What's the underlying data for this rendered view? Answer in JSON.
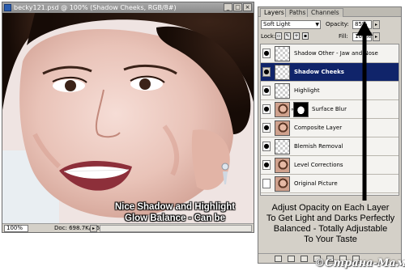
{
  "document": {
    "title": "becky121.psd @ 100% (Shadow Cheeks, RGB/8#)",
    "zoom": "100%",
    "doc_info": "Doc: 698.7K/6.54M",
    "overlay_text": "Nice Shadow and Highlight\nGlow Balance - Can be\nMore Dramatic if You Want"
  },
  "window_buttons": {
    "minimize": "_",
    "maximize": "□",
    "close": "×"
  },
  "layers_panel": {
    "tabs": [
      {
        "label": "Layers",
        "active": true
      },
      {
        "label": "Paths",
        "active": false
      },
      {
        "label": "Channels",
        "active": false
      }
    ],
    "blend_mode": "Soft Light",
    "opacity_label": "Opacity:",
    "opacity_value": "85%",
    "lock_label": "Lock:",
    "fill_label": "Fill:",
    "fill_value": "100%",
    "layers": [
      {
        "name": "Shadow Other - Jaw and Nose",
        "visible": true,
        "selected": false,
        "thumb": "checker"
      },
      {
        "name": "Shadow Cheeks",
        "visible": true,
        "selected": true,
        "thumb": "checker"
      },
      {
        "name": "Highlight",
        "visible": true,
        "selected": false,
        "thumb": "checker"
      },
      {
        "name": "Surface Blur",
        "visible": true,
        "selected": false,
        "thumb": "face",
        "mask": true
      },
      {
        "name": "Composite Layer",
        "visible": true,
        "selected": false,
        "thumb": "face"
      },
      {
        "name": "Blemish Removal",
        "visible": true,
        "selected": false,
        "thumb": "checker"
      },
      {
        "name": "Level Corrections",
        "visible": true,
        "selected": false,
        "thumb": "face"
      },
      {
        "name": "Original Picture",
        "visible": false,
        "selected": false,
        "thumb": "face"
      }
    ]
  },
  "caption": "Adjust Opacity on Each Layer\nTo Get Light and Darks Perfectly\nBalanced - Totally Adjustable\nTo Your Taste",
  "watermark": "©Страна-Мам",
  "colors": {
    "selected_layer": "#10246a",
    "panel_bg": "#d4d0c8"
  }
}
